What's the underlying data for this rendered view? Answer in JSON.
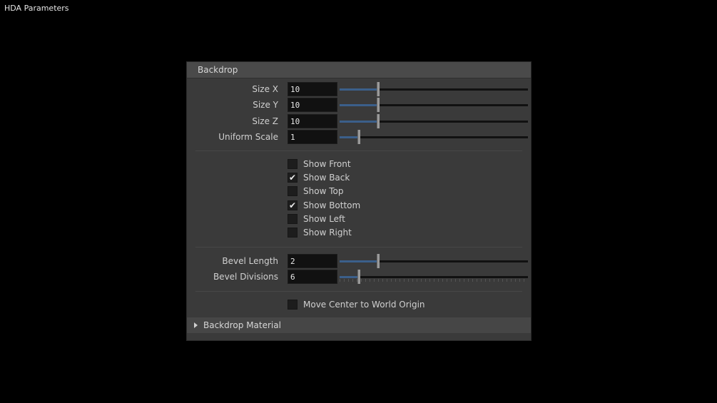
{
  "window": {
    "title": "HDA Parameters"
  },
  "panel": {
    "title": "Backdrop",
    "sliders": [
      {
        "label": "Size X",
        "value": "10",
        "fraction": 0.2
      },
      {
        "label": "Size Y",
        "value": "10",
        "fraction": 0.2
      },
      {
        "label": "Size Z",
        "value": "10",
        "fraction": 0.2
      },
      {
        "label": "Uniform Scale",
        "value": "1",
        "fraction": 0.1
      }
    ],
    "checkboxes": [
      {
        "label": "Show Front",
        "checked": false
      },
      {
        "label": "Show Back",
        "checked": true
      },
      {
        "label": "Show Top",
        "checked": false
      },
      {
        "label": "Show Bottom",
        "checked": true
      },
      {
        "label": "Show Left",
        "checked": false
      },
      {
        "label": "Show Right",
        "checked": false
      }
    ],
    "bevel": [
      {
        "label": "Bevel Length",
        "value": "2",
        "fraction": 0.2
      },
      {
        "label": "Bevel Divisions",
        "value": "6",
        "fraction": 0.1,
        "ticks": true
      }
    ],
    "move_center": {
      "label": "Move Center to World Origin",
      "checked": false
    },
    "footer": {
      "label": "Backdrop Material"
    }
  },
  "colors": {
    "accent": "#3b5f8a",
    "panel_bg": "#3a3a3a",
    "header_bg": "#4a4a4a"
  }
}
